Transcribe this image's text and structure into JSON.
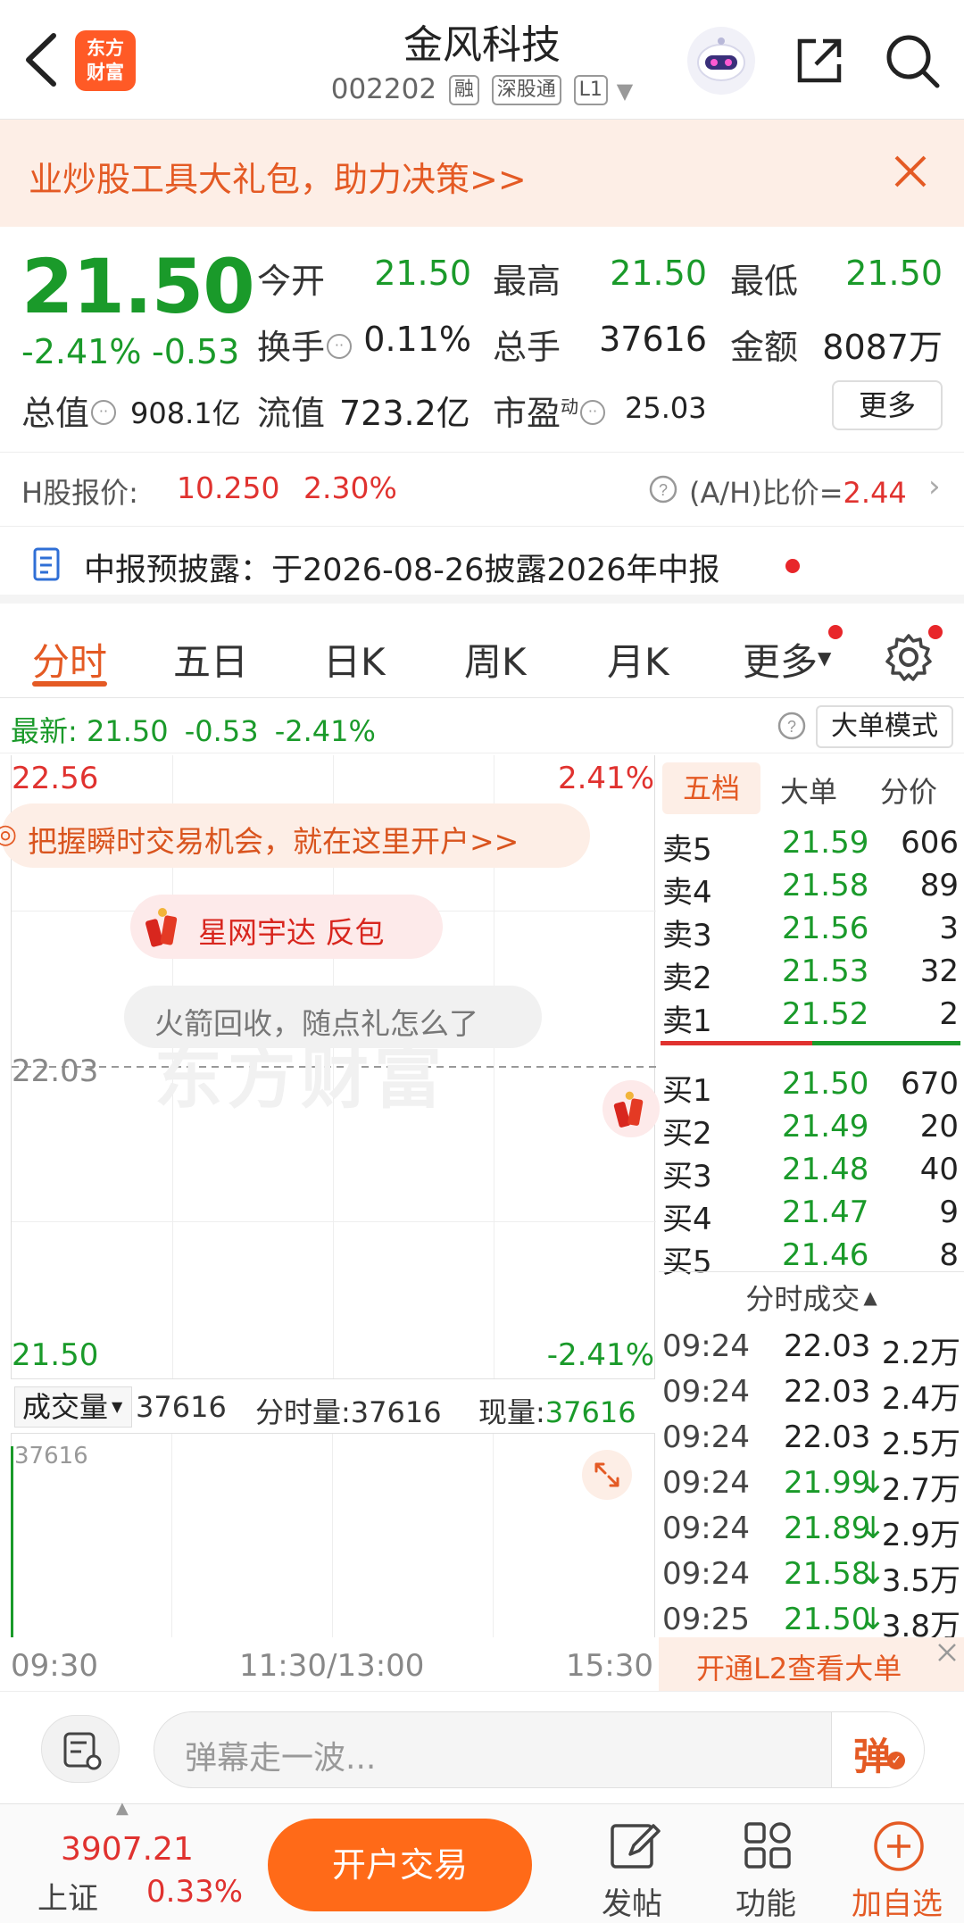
{
  "header": {
    "logo_line1": "东方",
    "logo_line2": "财富",
    "stock_name": "金风科技",
    "stock_code": "002202",
    "tag_rong": "融",
    "tag_sgt": "深股通",
    "tag_level": "L1"
  },
  "promo": {
    "text": "业炒股工具大礼包，助力决策>>"
  },
  "quote": {
    "price": "21.50",
    "change_pct": "-2.41%",
    "change_amt": "-0.53",
    "open_label": "今开",
    "open": "21.50",
    "high_label": "最高",
    "high": "21.50",
    "low_label": "最低",
    "low": "21.50",
    "turnover_label": "换手",
    "turnover": "0.11%",
    "volume_label": "总手",
    "volume": "37616",
    "amount_label": "金额",
    "amount": "8087万",
    "mktcap_label": "总值",
    "mktcap": "908.1亿",
    "float_label": "流值",
    "float_cap": "723.2亿",
    "pe_label": "市盈",
    "pe_sup": "动",
    "pe": "25.03",
    "more": "更多"
  },
  "hshare": {
    "label": "H股报价:",
    "price": "10.250",
    "pct": "2.30%",
    "ratio_label": "(A/H)比价=",
    "ratio": "2.44"
  },
  "report": {
    "text": "中报预披露：于2026-08-26披露2026年中报"
  },
  "tabs": [
    "分时",
    "五日",
    "日K",
    "周K",
    "月K",
    "更多"
  ],
  "latest": {
    "label": "最新:",
    "price": "21.50",
    "chg": "-0.53",
    "pct": "-2.41%",
    "mode_button": "大单模式"
  },
  "chart": {
    "top_price": "22.56",
    "top_pct": "2.41%",
    "mid_price": "22.03",
    "bottom_price": "21.50",
    "bottom_pct": "-2.41%",
    "open_account_banner": "把握瞬时交易机会，就在这里开户>>",
    "redpack_label": "星网宇达  反包",
    "rocket_tip": "火箭回收，随点礼怎么了",
    "watermark": "东方财富",
    "time_start": "09:30",
    "time_mid": "11:30/13:00",
    "time_end": "15:30"
  },
  "volume": {
    "selector": "成交量",
    "value": "37616",
    "fs_label": "分时量:",
    "fs_value": "37616",
    "now_label": "现量:",
    "now_value": "37616",
    "axis_max": "37616"
  },
  "orderbook": {
    "tabs": [
      "五档",
      "大单",
      "分价"
    ],
    "asks": [
      {
        "label": "卖5",
        "price": "21.59",
        "qty": "606"
      },
      {
        "label": "卖4",
        "price": "21.58",
        "qty": "89"
      },
      {
        "label": "卖3",
        "price": "21.56",
        "qty": "3"
      },
      {
        "label": "卖2",
        "price": "21.53",
        "qty": "32"
      },
      {
        "label": "卖1",
        "price": "21.52",
        "qty": "2"
      }
    ],
    "bids": [
      {
        "label": "买1",
        "price": "21.50",
        "qty": "670"
      },
      {
        "label": "买2",
        "price": "21.49",
        "qty": "20"
      },
      {
        "label": "买3",
        "price": "21.48",
        "qty": "40"
      },
      {
        "label": "买4",
        "price": "21.47",
        "qty": "9"
      },
      {
        "label": "买5",
        "price": "21.46",
        "qty": "8"
      }
    ],
    "trades_title": "分时成交",
    "trades": [
      {
        "time": "09:24",
        "price": "22.03",
        "arrow": "",
        "vol": "2.2万"
      },
      {
        "time": "09:24",
        "price": "22.03",
        "arrow": "",
        "vol": "2.4万"
      },
      {
        "time": "09:24",
        "price": "22.03",
        "arrow": "",
        "vol": "2.5万"
      },
      {
        "time": "09:24",
        "price": "21.99",
        "arrow": "↓",
        "vol": "2.7万"
      },
      {
        "time": "09:24",
        "price": "21.89",
        "arrow": "↓",
        "vol": "2.9万"
      },
      {
        "time": "09:24",
        "price": "21.58",
        "arrow": "↓",
        "vol": "3.5万"
      },
      {
        "time": "09:25",
        "price": "21.50",
        "arrow": "↓",
        "vol": "3.8万"
      }
    ],
    "l2_promo": "开通L2查看大单"
  },
  "danmaku": {
    "placeholder": "弹幕走一波...",
    "button": "弹"
  },
  "bottom": {
    "index_value": "3907.21",
    "index_name": "上证",
    "index_pct": "0.33%",
    "trade_button": "开户交易",
    "post": "发帖",
    "function": "功能",
    "add_watch": "加自选"
  }
}
